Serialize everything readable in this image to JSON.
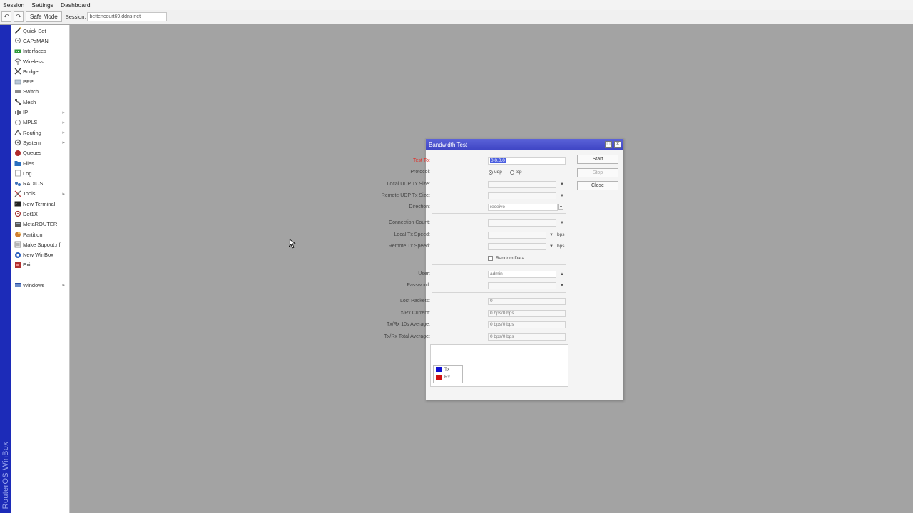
{
  "menubar": {
    "items": [
      "Session",
      "Settings",
      "Dashboard"
    ]
  },
  "toolbar": {
    "undo_icon": "undo-icon",
    "redo_icon": "redo-icon",
    "safe_mode_label": "Safe Mode",
    "session_label": "Session:",
    "session_value": "bettencourt69.ddns.net"
  },
  "brand": {
    "text": "RouterOS WinBox",
    "color": "#1c2bb8"
  },
  "sidebar": {
    "items": [
      {
        "label": "Quick Set",
        "icon": "wand-icon",
        "submenu": false
      },
      {
        "label": "CAPsMAN",
        "icon": "capsman-icon",
        "submenu": false
      },
      {
        "label": "Interfaces",
        "icon": "interfaces-icon",
        "submenu": false
      },
      {
        "label": "Wireless",
        "icon": "wireless-icon",
        "submenu": false
      },
      {
        "label": "Bridge",
        "icon": "bridge-icon",
        "submenu": false
      },
      {
        "label": "PPP",
        "icon": "ppp-icon",
        "submenu": false
      },
      {
        "label": "Switch",
        "icon": "switch-icon",
        "submenu": false
      },
      {
        "label": "Mesh",
        "icon": "mesh-icon",
        "submenu": false
      },
      {
        "label": "IP",
        "icon": "ip-icon",
        "submenu": true
      },
      {
        "label": "MPLS",
        "icon": "mpls-icon",
        "submenu": true
      },
      {
        "label": "Routing",
        "icon": "routing-icon",
        "submenu": true
      },
      {
        "label": "System",
        "icon": "system-icon",
        "submenu": true
      },
      {
        "label": "Queues",
        "icon": "queues-icon",
        "submenu": false
      },
      {
        "label": "Files",
        "icon": "files-icon",
        "submenu": false
      },
      {
        "label": "Log",
        "icon": "log-icon",
        "submenu": false
      },
      {
        "label": "RADIUS",
        "icon": "radius-icon",
        "submenu": false
      },
      {
        "label": "Tools",
        "icon": "tools-icon",
        "submenu": true
      },
      {
        "label": "New Terminal",
        "icon": "terminal-icon",
        "submenu": false
      },
      {
        "label": "Dot1X",
        "icon": "dot1x-icon",
        "submenu": false
      },
      {
        "label": "MetaROUTER",
        "icon": "metarouter-icon",
        "submenu": false
      },
      {
        "label": "Partition",
        "icon": "partition-icon",
        "submenu": false
      },
      {
        "label": "Make Supout.rif",
        "icon": "supout-icon",
        "submenu": false
      },
      {
        "label": "New WinBox",
        "icon": "winbox-icon",
        "submenu": false
      },
      {
        "label": "Exit",
        "icon": "exit-icon",
        "submenu": false
      }
    ],
    "windows_label": "Windows"
  },
  "dialog": {
    "title": "Bandwidth Test",
    "fields": {
      "test_to": {
        "label": "Test To:",
        "value": "0.0.0.0"
      },
      "protocol": {
        "label": "Protocol:",
        "options": [
          "udp",
          "tcp"
        ],
        "selected": "udp"
      },
      "local_udp_tx_size": {
        "label": "Local UDP Tx Size:",
        "value": ""
      },
      "remote_udp_tx_size": {
        "label": "Remote UDP Tx Size:",
        "value": ""
      },
      "direction": {
        "label": "Direction:",
        "value": "receive"
      },
      "connection_count": {
        "label": "Connection Count:",
        "value": ""
      },
      "local_tx_speed": {
        "label": "Local Tx Speed:",
        "value": "",
        "unit": "bps"
      },
      "remote_tx_speed": {
        "label": "Remote Tx Speed:",
        "value": "",
        "unit": "bps"
      },
      "random_data": {
        "label": "Random Data",
        "checked": false
      },
      "user": {
        "label": "User:",
        "value": "admin"
      },
      "password": {
        "label": "Password:",
        "value": ""
      },
      "lost_packets": {
        "label": "Lost Packets:",
        "value": "0"
      },
      "txrx_current": {
        "label": "Tx/Rx Current:",
        "value": "0 bps/0 bps"
      },
      "txrx_10s_avg": {
        "label": "Tx/Rx 10s Average:",
        "value": "0 bps/0 bps"
      },
      "txrx_total_avg": {
        "label": "Tx/Rx Total Average:",
        "value": "0 bps/0 bps"
      }
    },
    "buttons": {
      "start": "Start",
      "stop": "Stop",
      "close": "Close"
    },
    "legend": [
      {
        "label": "Tx",
        "color": "#1010d0"
      },
      {
        "label": "Rx",
        "color": "#d01010"
      }
    ]
  }
}
